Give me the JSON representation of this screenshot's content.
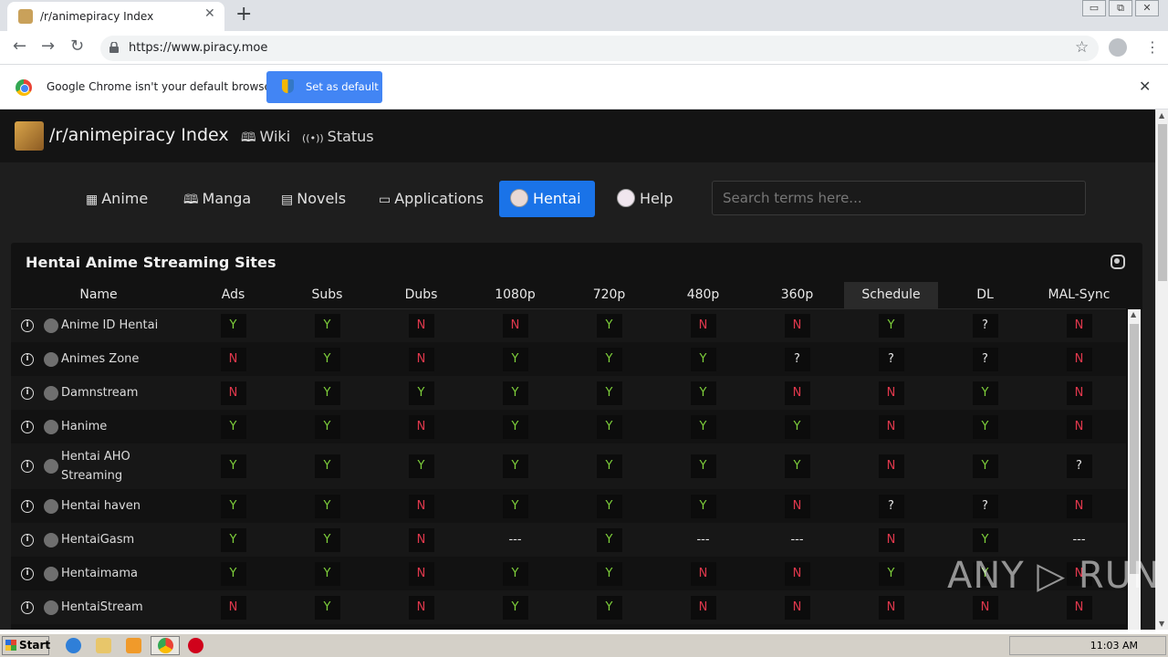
{
  "browser": {
    "tab_title": "/r/animepiracy Index",
    "tab_close": "✕",
    "new_tab": "+",
    "url": "https://www.piracy.moe",
    "window_buttons": [
      "▭",
      "⧉",
      "✕"
    ]
  },
  "infobar": {
    "message": "Google Chrome isn't your default browser",
    "button": "Set as default",
    "close": "✕"
  },
  "site": {
    "title": "/r/animepiracy Index",
    "links": [
      {
        "icon": "book-icon",
        "glyph": "🕮",
        "label": "Wiki"
      },
      {
        "icon": "broadcast-icon",
        "glyph": "((•))",
        "label": "Status"
      }
    ],
    "categories": [
      {
        "icon": "film-icon",
        "glyph": "▦",
        "label": "Anime"
      },
      {
        "icon": "book-icon",
        "glyph": "🕮",
        "label": "Manga"
      },
      {
        "icon": "list-icon",
        "glyph": "▤",
        "label": "Novels"
      },
      {
        "icon": "window-icon",
        "glyph": "▭",
        "label": "Applications"
      },
      {
        "icon": "avatar-icon",
        "glyph": "",
        "label": "Hentai"
      },
      {
        "icon": "avatar-icon",
        "glyph": "",
        "label": "Help"
      }
    ],
    "search_placeholder": "Search terms here..."
  },
  "table": {
    "title": "Hentai Anime Streaming Sites",
    "columns": [
      "Name",
      "Ads",
      "Subs",
      "Dubs",
      "1080p",
      "720p",
      "480p",
      "360p",
      "Schedule",
      "DL",
      "MAL-Sync"
    ],
    "rows": [
      {
        "name": "Anime ID Hentai",
        "values": [
          "Y",
          "Y",
          "N",
          "N",
          "Y",
          "N",
          "N",
          "Y",
          "?",
          "N"
        ]
      },
      {
        "name": "Animes Zone",
        "values": [
          "N",
          "Y",
          "N",
          "Y",
          "Y",
          "Y",
          "?",
          "?",
          "?",
          "N"
        ]
      },
      {
        "name": "Damnstream",
        "values": [
          "N",
          "Y",
          "Y",
          "Y",
          "Y",
          "Y",
          "N",
          "N",
          "Y",
          "N"
        ]
      },
      {
        "name": "Hanime",
        "values": [
          "Y",
          "Y",
          "N",
          "Y",
          "Y",
          "Y",
          "Y",
          "N",
          "Y",
          "N"
        ]
      },
      {
        "name": "Hentai AHO Streaming",
        "values": [
          "Y",
          "Y",
          "Y",
          "Y",
          "Y",
          "Y",
          "Y",
          "N",
          "Y",
          "?"
        ]
      },
      {
        "name": "Hentai haven",
        "values": [
          "Y",
          "Y",
          "N",
          "Y",
          "Y",
          "Y",
          "N",
          "?",
          "?",
          "N"
        ]
      },
      {
        "name": "HentaiGasm",
        "values": [
          "Y",
          "Y",
          "N",
          "---",
          "Y",
          "---",
          "---",
          "N",
          "Y",
          "---"
        ]
      },
      {
        "name": "Hentaimama",
        "values": [
          "Y",
          "Y",
          "N",
          "Y",
          "Y",
          "N",
          "N",
          "Y",
          "Y",
          "N"
        ]
      },
      {
        "name": "HentaiStream",
        "values": [
          "N",
          "Y",
          "N",
          "Y",
          "Y",
          "N",
          "N",
          "N",
          "N",
          "N"
        ]
      }
    ]
  },
  "watermark": "ANY ▷ RUN",
  "taskbar": {
    "start": "Start",
    "clock": "11:03 AM"
  },
  "colors": {
    "yes": "#7fd13b",
    "no": "#e2384d",
    "accent": "#1a73e8"
  }
}
